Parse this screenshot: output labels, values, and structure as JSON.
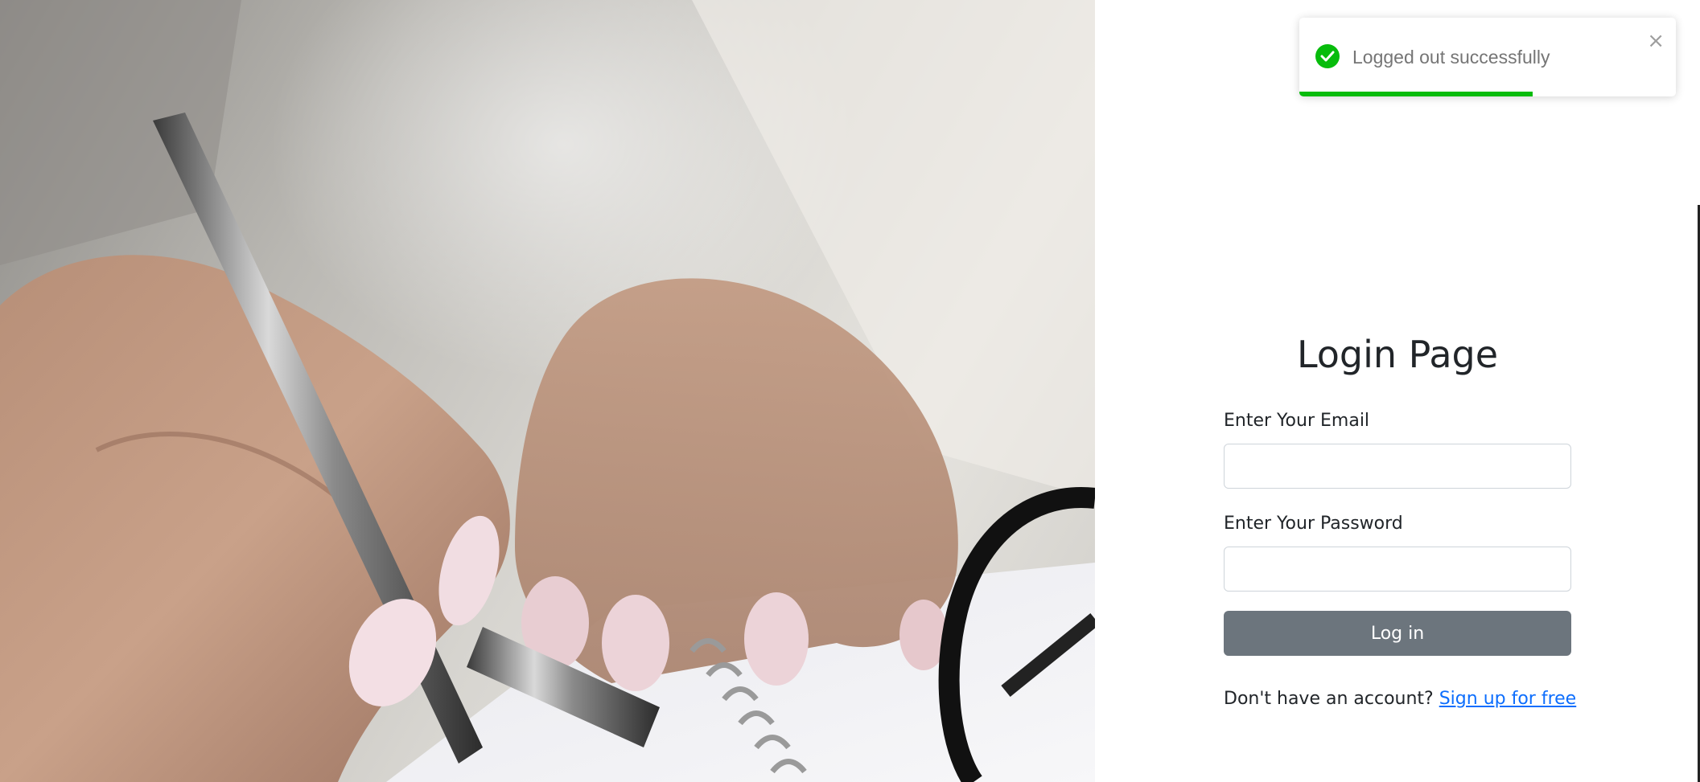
{
  "login": {
    "title": "Login Page",
    "email_label": "Enter Your Email",
    "email_value": "",
    "email_placeholder": "",
    "password_label": "Enter Your Password",
    "password_value": "",
    "password_placeholder": "",
    "submit_label": "Log in",
    "signup_prompt": "Don't have an account?",
    "signup_link": "Sign up for free"
  },
  "toast": {
    "message": "Logged out successfully",
    "close_glyph": "×",
    "icon": "check-circle-icon",
    "progress_fraction": 0.62,
    "color": "#07bc0c"
  },
  "hero": {
    "image": "hand-writing-with-pen-photo"
  },
  "colors": {
    "button_bg": "#6c757d",
    "link": "#0d6efd",
    "success": "#07bc0c"
  }
}
